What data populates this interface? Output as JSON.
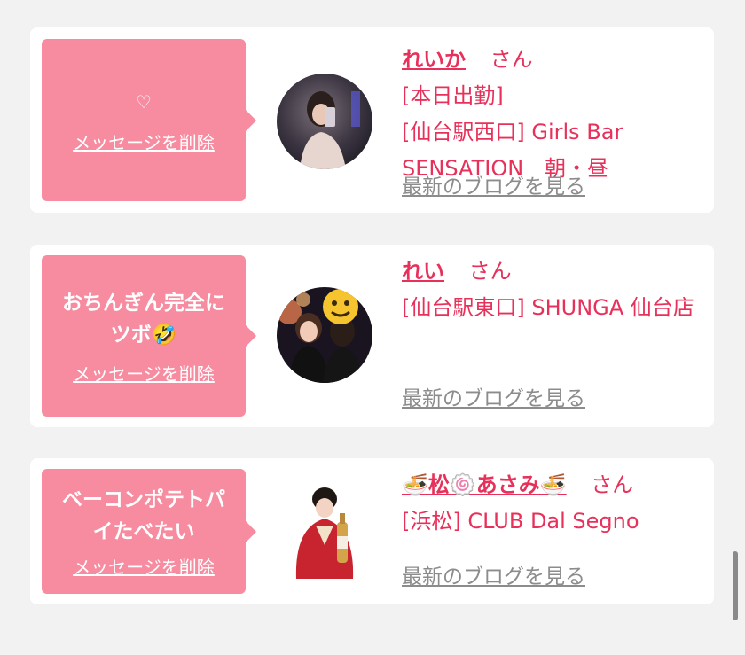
{
  "cards": [
    {
      "message": "♡",
      "delete_label": "メッセージを削除",
      "name": "れいか",
      "honorific": "さん",
      "detail": "[本日出勤]\n[仙台駅西口] Girls Bar SENSATION　朝・昼",
      "blog_label": "最新のブログを見る"
    },
    {
      "message": "おちんぎん完全にツボ🤣",
      "delete_label": "メッセージを削除",
      "name": "れい",
      "honorific": "さん",
      "detail": "[仙台駅東口] SHUNGA 仙台店",
      "blog_label": "最新のブログを見る"
    },
    {
      "message": "ベーコンポテトパイたべたい",
      "delete_label": "メッセージを削除",
      "name": "🍜松🍥あさみ🍜",
      "honorific": "さん",
      "detail": "[浜松] CLUB Dal Segno",
      "blog_label": "最新のブログを見る"
    }
  ],
  "colors": {
    "accent": "#e8315a",
    "bubble": "#f78ca0",
    "background": "#f2f2f3",
    "link_gray": "#8c8c8c"
  }
}
